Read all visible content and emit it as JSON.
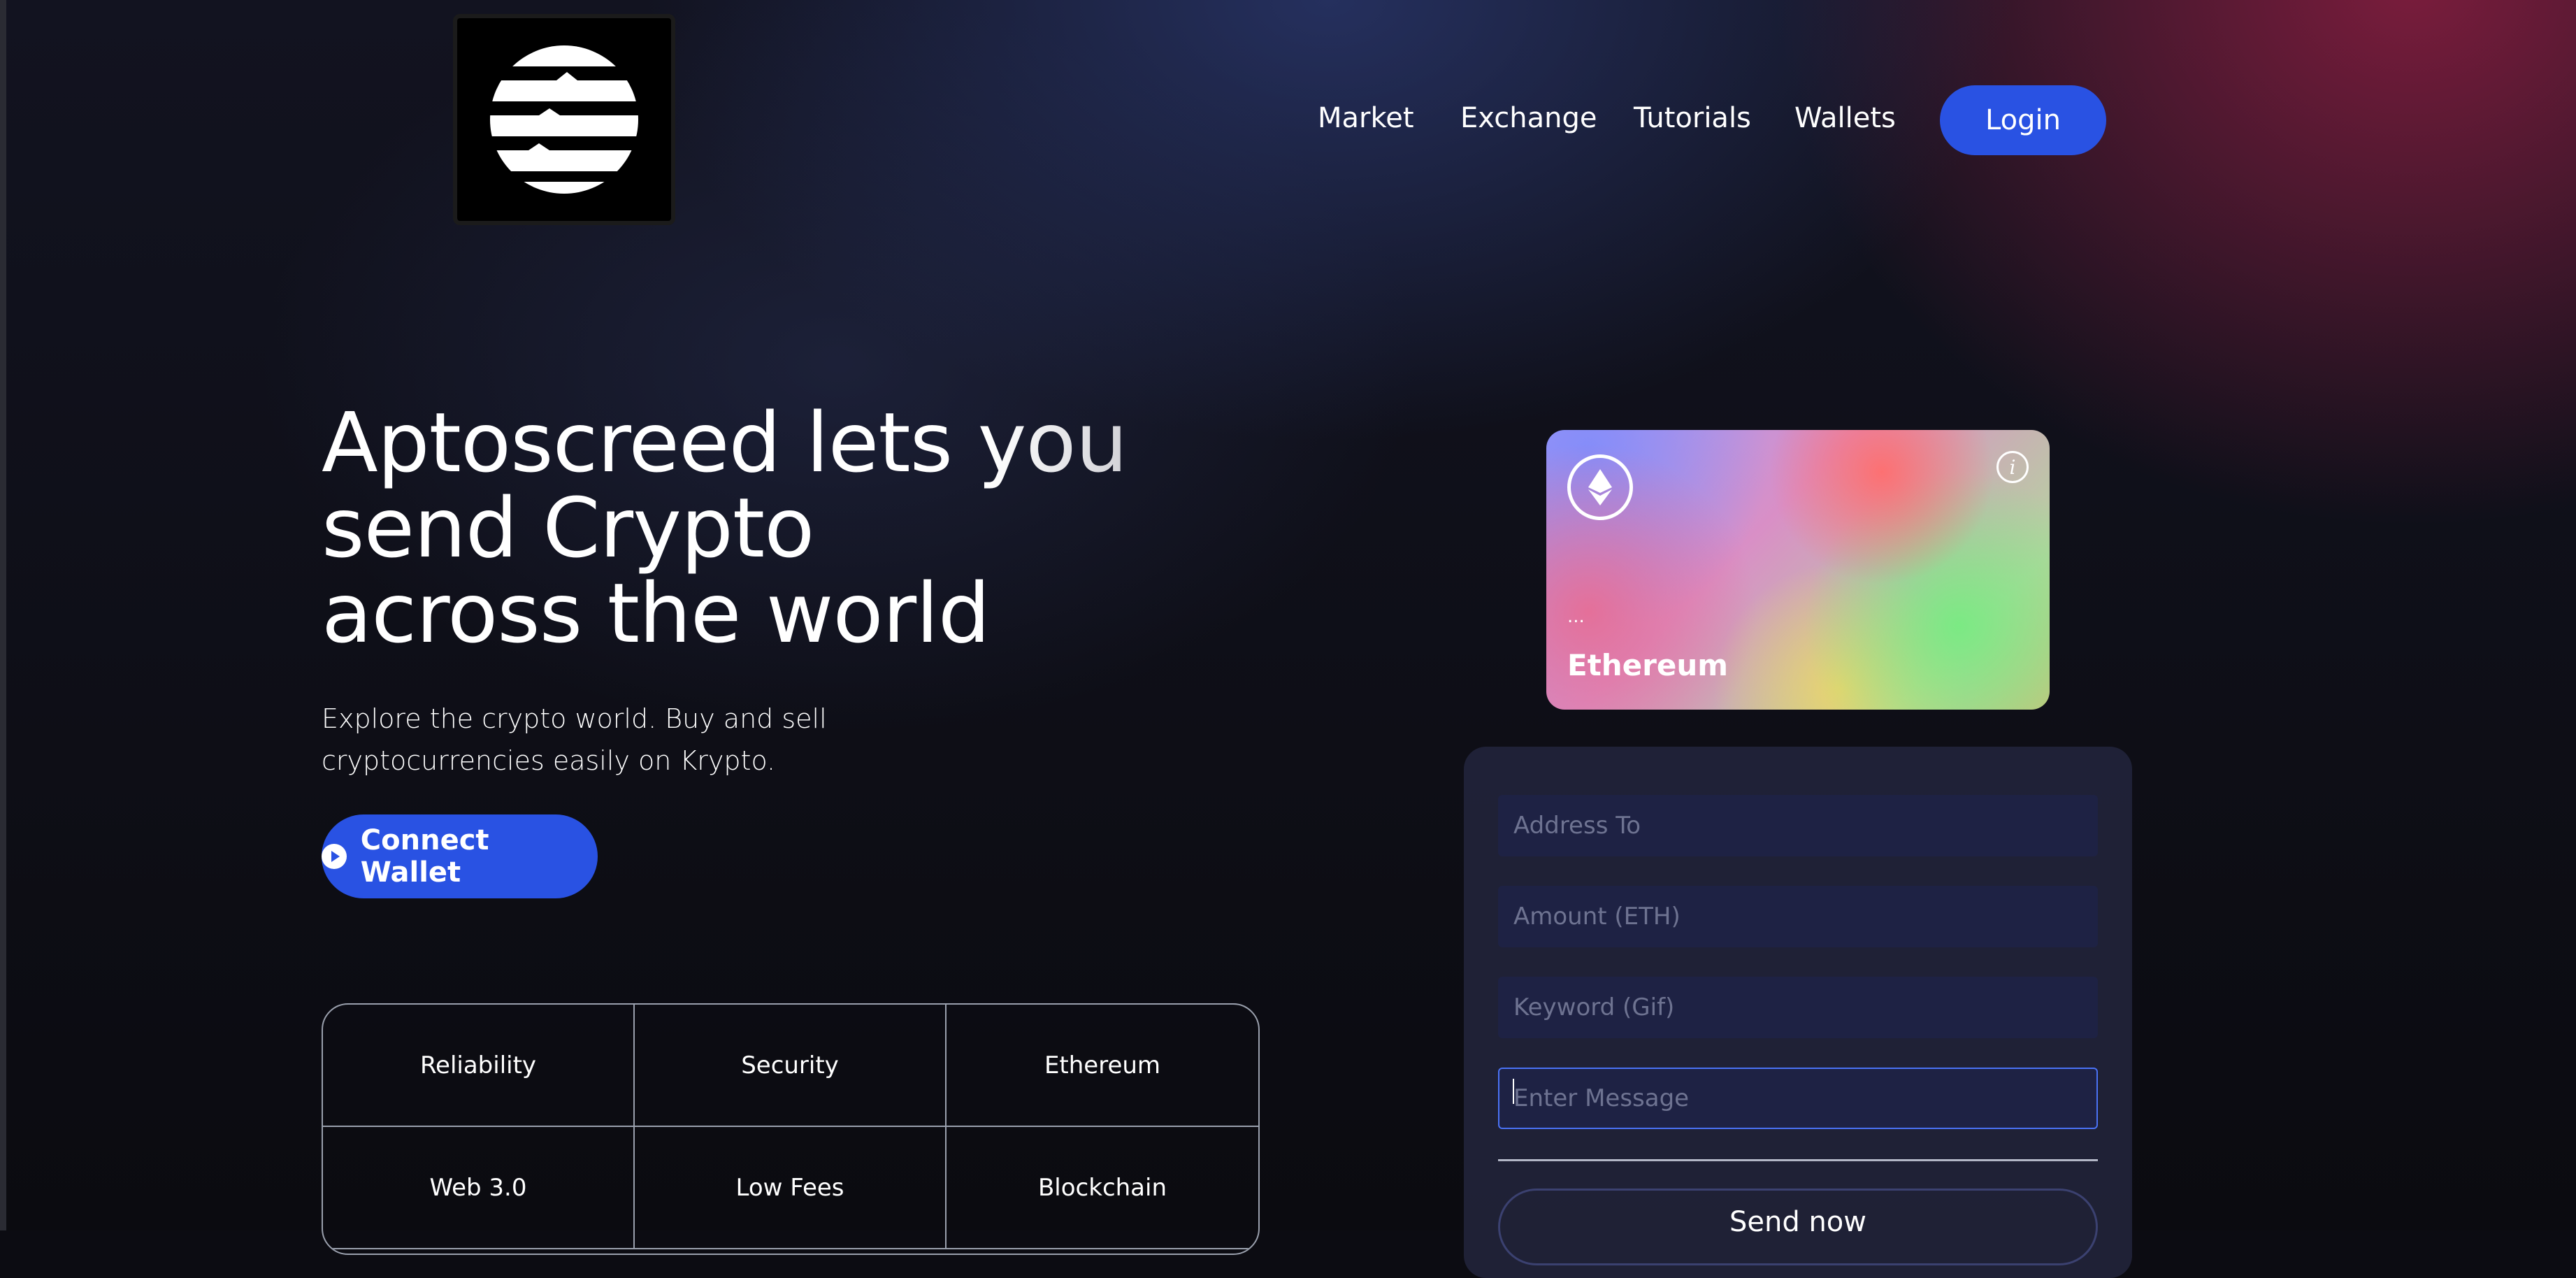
{
  "nav": {
    "links": [
      "Market",
      "Exchange",
      "Tutorials",
      "Wallets"
    ],
    "login_label": "Login"
  },
  "hero": {
    "title_line1": "Aptoscreed lets you send Crypto",
    "title_line2": "across the world",
    "subtitle": "Explore the crypto world. Buy and sell cryptocurrencies easily on Krypto.",
    "connect_label": "Connect Wallet"
  },
  "features": [
    "Reliability",
    "Security",
    "Ethereum",
    "Web 3.0",
    "Low Fees",
    "Blockchain"
  ],
  "eth_card": {
    "address": "...",
    "name": "Ethereum"
  },
  "form": {
    "address_placeholder": "Address To",
    "amount_placeholder": "Amount (ETH)",
    "keyword_placeholder": "Keyword (Gif)",
    "message_placeholder": "Enter Message",
    "send_label": "Send now"
  },
  "colors": {
    "accent": "#2952e3",
    "input_bg": "#1e2244",
    "focus_border": "#4a72f5"
  }
}
